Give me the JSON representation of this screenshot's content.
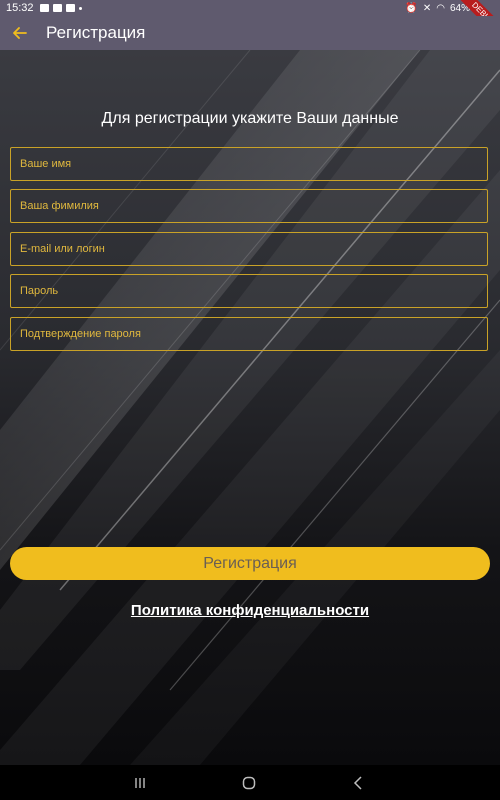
{
  "status_bar": {
    "time": "15:32",
    "battery": "64%"
  },
  "debug_banner": "DEBUG",
  "app_bar": {
    "title": "Регистрация"
  },
  "form": {
    "heading": "Для регистрации укажите Ваши данные",
    "fields": [
      {
        "placeholder": "Ваше имя",
        "value": ""
      },
      {
        "placeholder": "Ваша фимилия",
        "value": ""
      },
      {
        "placeholder": "E-mail или логин",
        "value": ""
      },
      {
        "placeholder": "Пароль",
        "value": ""
      },
      {
        "placeholder": "Подтверждение пароля",
        "value": ""
      }
    ],
    "submit_label": "Регистрация",
    "privacy_link": "Политика конфиденциальности"
  },
  "colors": {
    "accent": "#f0bd1e",
    "field_border": "#c9a227",
    "app_bar": "#5f5a6e",
    "button_text": "#6a5f54"
  },
  "nav_bar": {
    "icons": [
      "recent-apps-icon",
      "home-icon",
      "back-icon"
    ]
  }
}
